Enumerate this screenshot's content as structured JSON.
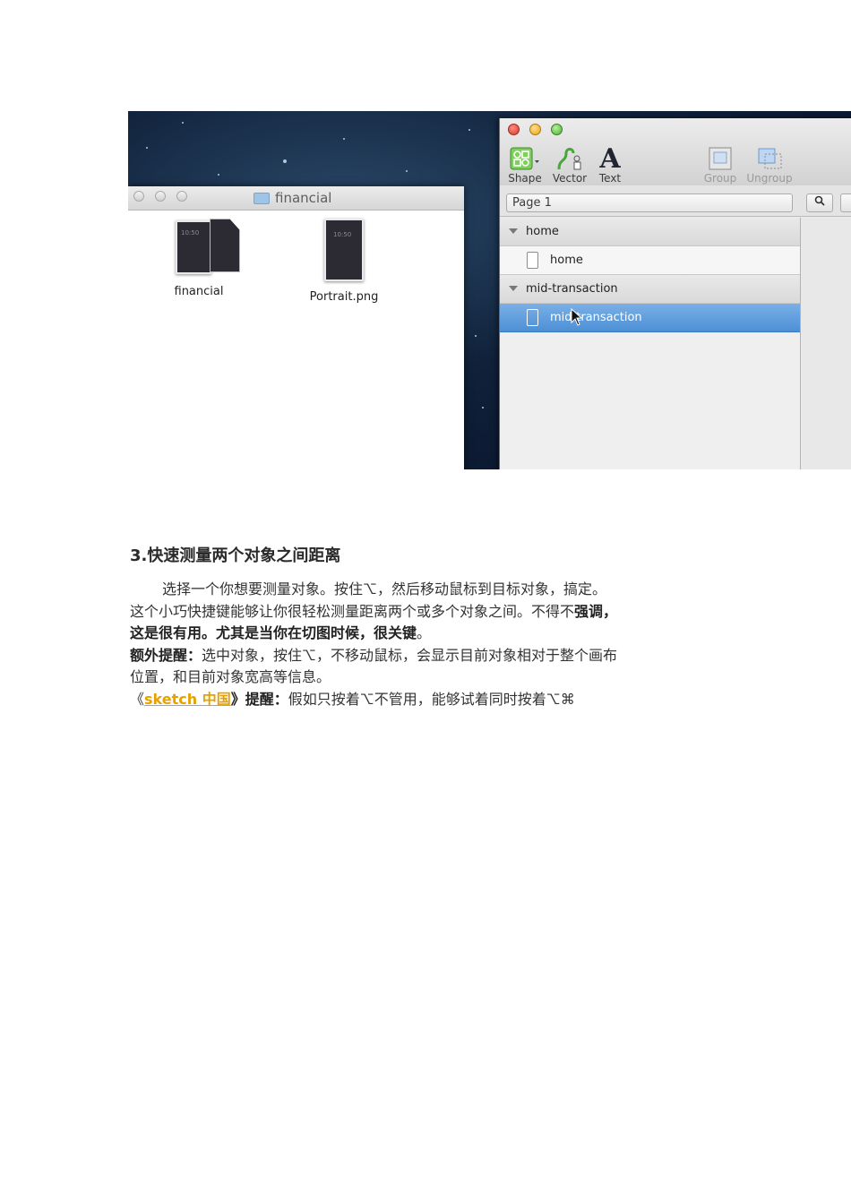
{
  "finder": {
    "title": "financial",
    "files": [
      {
        "label": "financial",
        "thumb_text": "10:50"
      },
      {
        "label": "Portrait.png",
        "thumb_text": "10:50"
      }
    ]
  },
  "sketch": {
    "toolbar": {
      "shape": "Shape",
      "vector": "Vector",
      "text": "Text",
      "group": "Group",
      "ungroup": "Ungroup"
    },
    "page_select": "Page 1",
    "layers": [
      {
        "name": "home",
        "kind": "group"
      },
      {
        "name": "home",
        "kind": "artboard"
      },
      {
        "name": "mid-transaction",
        "kind": "group"
      },
      {
        "name": "mid-transaction",
        "kind": "artboard",
        "selected": true
      }
    ]
  },
  "article": {
    "heading": "3.快速测量两个对象之间距离",
    "p1": "选择一个你想要测量对象。按住⌥，然后移动鼠标到目标对象，搞定。",
    "p2_a": "这个小巧快捷键能够让你很轻松测量距离两个或多个对象之间。不得不",
    "p2_b": "强调，",
    "p3_a": "这是很有用。尤其是当你在切图时候，很关键",
    "p3_b": "。",
    "p4_a": "额外提醒：",
    "p4_b": "选中对象，按住⌥，不移动鼠标，会显示目前对象相对于整个画布",
    "p5": "位置，和目前对象宽高等信息。",
    "p6_open": "《",
    "p6_link": "sketch 中国",
    "p6_close": "》提醒：",
    "p6_rest": "假如只按着⌥不管用，能够试着同时按着⌥⌘"
  }
}
